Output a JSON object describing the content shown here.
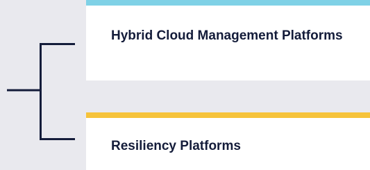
{
  "colors": {
    "background": "#e9e9ee",
    "connector": "#141c3a",
    "card_background": "#ffffff",
    "text": "#141c3a"
  },
  "items": [
    {
      "label": "Hybrid Cloud Management Platforms",
      "accent": "#7fd1e6"
    },
    {
      "label": "Resiliency Platforms",
      "accent": "#f6c33a"
    }
  ]
}
